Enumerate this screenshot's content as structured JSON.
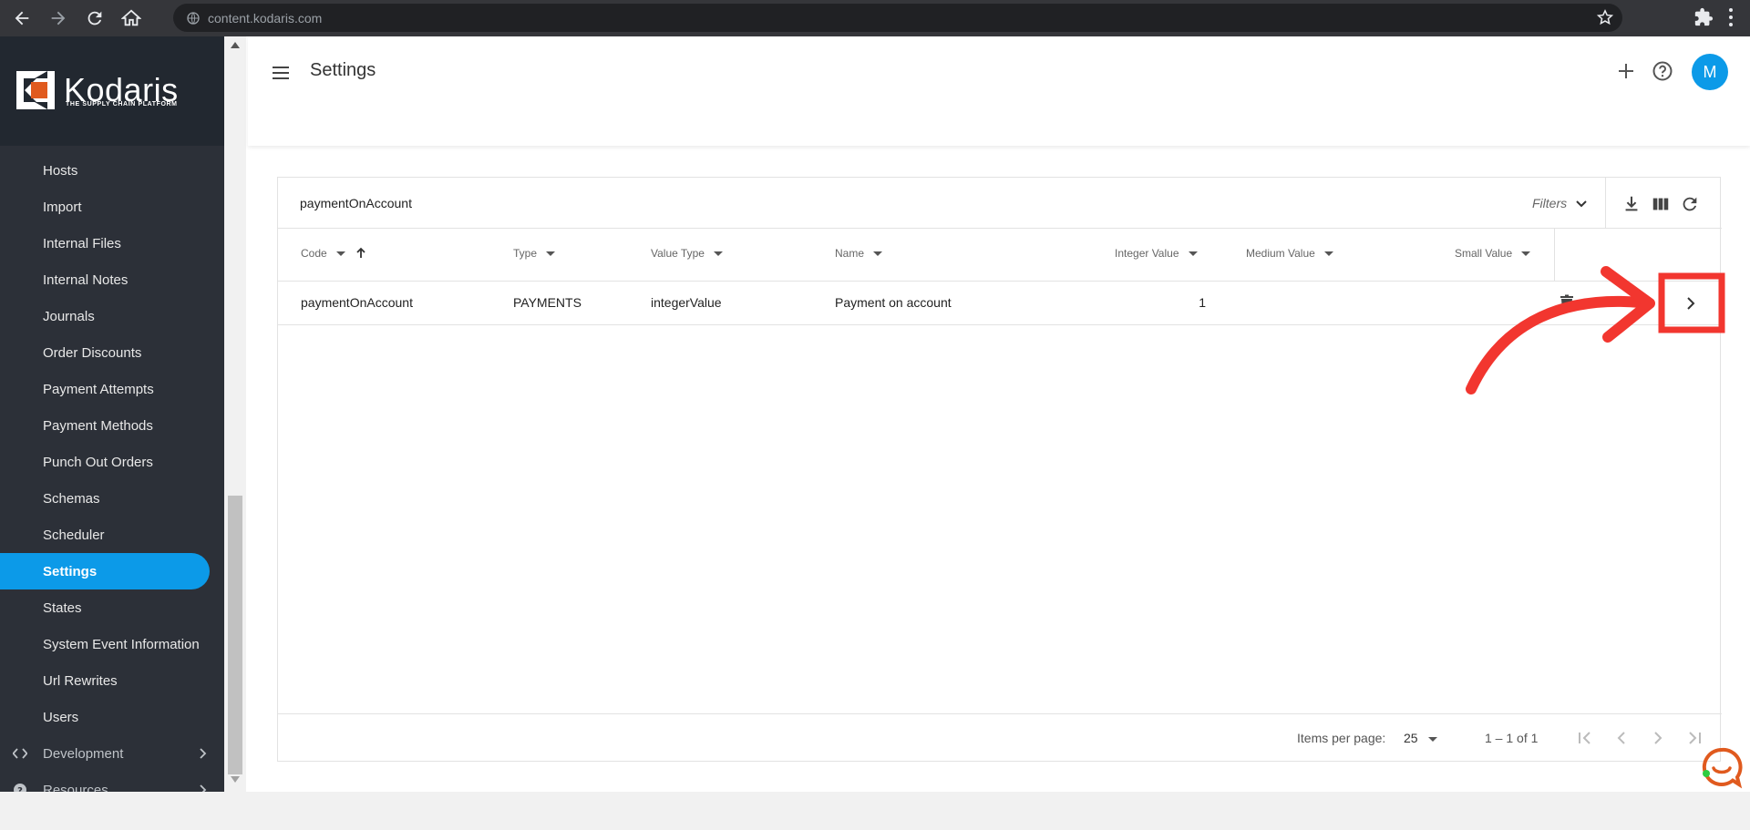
{
  "browser": {
    "url": "content.kodaris.com"
  },
  "logo": {
    "name": "Kodaris",
    "tagline": "THE SUPPLY CHAIN PLATFORM"
  },
  "sidebar": {
    "items": [
      {
        "label": "Hosts"
      },
      {
        "label": "Import"
      },
      {
        "label": "Internal Files"
      },
      {
        "label": "Internal Notes"
      },
      {
        "label": "Journals"
      },
      {
        "label": "Order Discounts"
      },
      {
        "label": "Payment Attempts"
      },
      {
        "label": "Payment Methods"
      },
      {
        "label": "Punch Out Orders"
      },
      {
        "label": "Schemas"
      },
      {
        "label": "Scheduler"
      },
      {
        "label": "Settings",
        "active": true
      },
      {
        "label": "States"
      },
      {
        "label": "System Event Information"
      },
      {
        "label": "Url Rewrites"
      },
      {
        "label": "Users"
      }
    ],
    "groups": [
      {
        "label": "Development",
        "icon": "code-icon"
      },
      {
        "label": "Resources",
        "icon": "help-circle-icon"
      }
    ]
  },
  "header": {
    "title": "Settings",
    "avatar_initial": "M"
  },
  "table": {
    "search_value": "paymentOnAccount",
    "filters_label": "Filters",
    "columns": [
      "Code",
      "Type",
      "Value Type",
      "Name",
      "Integer Value",
      "Medium Value",
      "Small Value"
    ],
    "rows": [
      {
        "code": "paymentOnAccount",
        "type": "PAYMENTS",
        "value_type": "integerValue",
        "name": "Payment on account",
        "integer_value": "1",
        "medium_value": "",
        "small_value": ""
      }
    ]
  },
  "pagination": {
    "items_per_page_label": "Items per page:",
    "items_per_page": "25",
    "range": "1 – 1 of 1"
  },
  "colors": {
    "accent": "#0c9ae8",
    "sidebar_bg": "#2c3038",
    "annotation": "#f2362f"
  }
}
